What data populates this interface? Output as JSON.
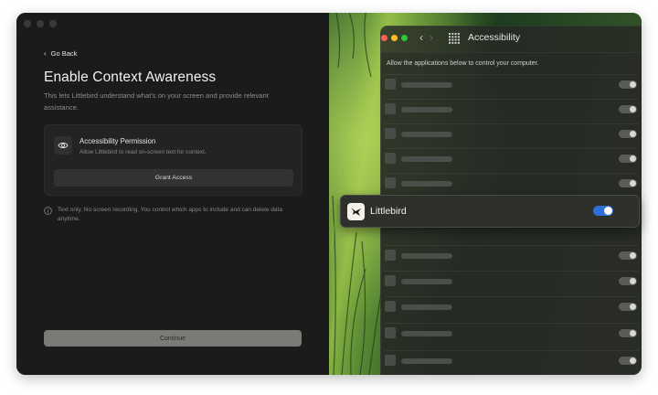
{
  "left": {
    "go_back": "Go Back",
    "title": "Enable Context Awareness",
    "subtitle": "This lets Littlebird understand what's on your screen and provide relevant assistance.",
    "card": {
      "icon": "eye-icon",
      "title": "Accessibility Permission",
      "description": "Allow Littlebird to read on-screen text for context.",
      "button": "Grant Access"
    },
    "info": {
      "icon": "info-icon",
      "text": "Text only. No screen recording. You control which apps to include and can delete data anytime."
    },
    "continue": "Continue"
  },
  "settings": {
    "title": "Accessibility",
    "description": "Allow the applications below to control your computer.",
    "highlighted_app": {
      "name": "Littlebird",
      "enabled": true,
      "accent": "#2f6fdb"
    }
  },
  "colors": {
    "background": "#1b1b1c",
    "continue_button": "#7a7a76",
    "traffic_red": "#ff5f57",
    "traffic_yellow": "#febc2e",
    "traffic_green": "#28c840"
  }
}
